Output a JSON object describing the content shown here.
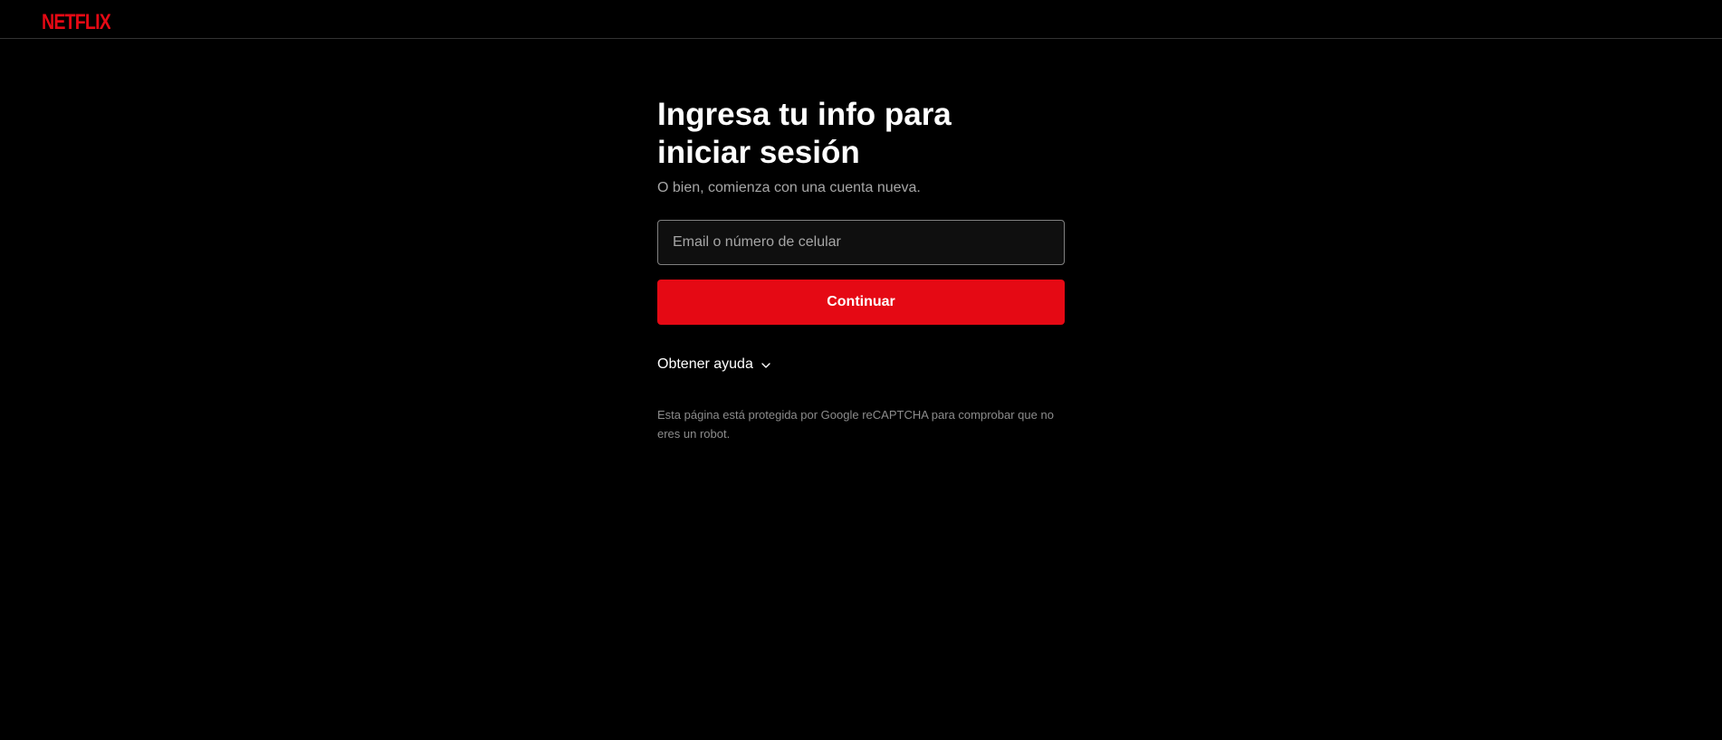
{
  "header": {
    "logo_text": "NETFLIX",
    "logo_color": "#e50914"
  },
  "login": {
    "title": "Ingresa tu info para iniciar sesión",
    "subtitle": "O bien, comienza con una cuenta nueva.",
    "email_placeholder": "Email o número de celular",
    "email_value": "",
    "continue_label": "Continuar",
    "help_label": "Obtener ayuda",
    "help_icon": "chevron-down-icon",
    "recaptcha_notice": "Esta página está protegida por Google reCAPTCHA para comprobar que no eres un robot."
  },
  "colors": {
    "background": "#000000",
    "accent": "#e50914",
    "muted_text": "#a6a6a6"
  }
}
